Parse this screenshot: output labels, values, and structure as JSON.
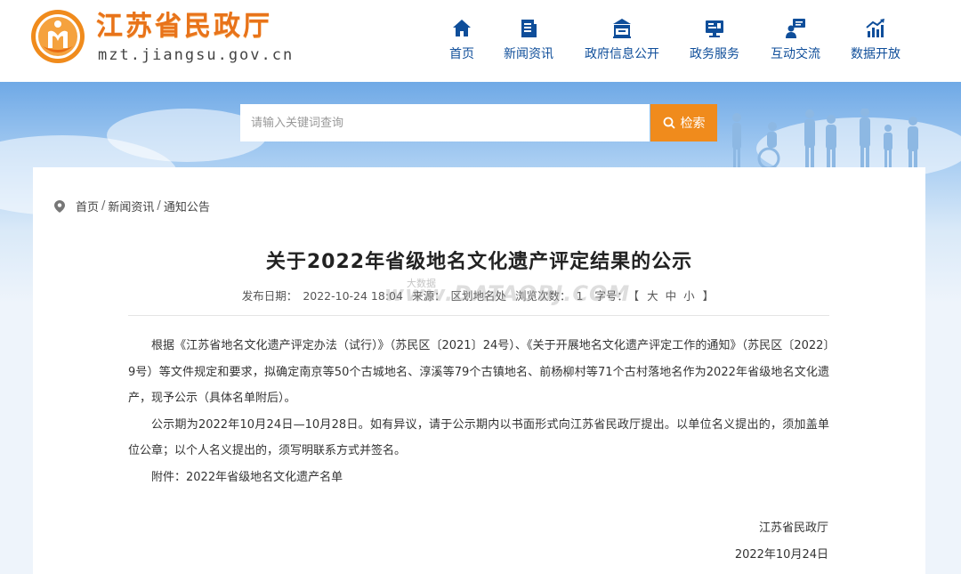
{
  "header": {
    "site_name": "江苏省民政厅",
    "site_domain": "mzt.jiangsu.gov.cn",
    "brand_color": "#e8731a",
    "nav_color": "#0f4e9a"
  },
  "nav": {
    "items": [
      {
        "label": "首页",
        "icon": "home-icon"
      },
      {
        "label": "新闻资讯",
        "icon": "news-icon"
      },
      {
        "label": "政府信息公开",
        "icon": "building-icon"
      },
      {
        "label": "政务服务",
        "icon": "monitor-icon"
      },
      {
        "label": "互动交流",
        "icon": "interaction-icon"
      },
      {
        "label": "数据开放",
        "icon": "chart-icon"
      }
    ]
  },
  "search": {
    "placeholder": "请输入关键词查询",
    "button_label": "检索",
    "button_color": "#f08b1c"
  },
  "breadcrumb": {
    "items": [
      "首页",
      "新闻资讯",
      "通知公告"
    ],
    "separator": "/"
  },
  "article": {
    "title": "关于2022年省级地名文化遗产评定结果的公示",
    "meta": {
      "date_label": "发布日期：",
      "date": "2022-10-24 18:04",
      "source_label": "来源：",
      "source": "区划地名处",
      "views_label": "浏览次数：",
      "views": "1",
      "fontsize_label": "字号：",
      "fontsize_open": "【",
      "fontsize_large": "大",
      "fontsize_medium": "中",
      "fontsize_small": "小",
      "fontsize_close": "】"
    },
    "paragraphs": [
      "根据《江苏省地名文化遗产评定办法（试行）》（苏民区〔2021〕24号）、《关于开展地名文化遗产评定工作的通知》（苏民区〔2022〕9号）等文件规定和要求，拟确定南京等50个古城地名、淳溪等79个古镇地名、前杨柳村等71个古村落地名作为2022年省级地名文化遗产，现予公示（具体名单附后）。",
      "公示期为2022年10月24日—10月28日。如有异议，请于公示期内以书面形式向江苏省民政厅提出。以单位名义提出的，须加盖单位公章；以个人名义提出的，须写明联系方式并签名。",
      "附件：2022年省级地名文化遗产名单"
    ],
    "signature_org": "江苏省民政厅",
    "signature_date": "2022年10月24日"
  },
  "watermark": {
    "text": "www.DATAOBJ.COM",
    "small": "大数据"
  }
}
